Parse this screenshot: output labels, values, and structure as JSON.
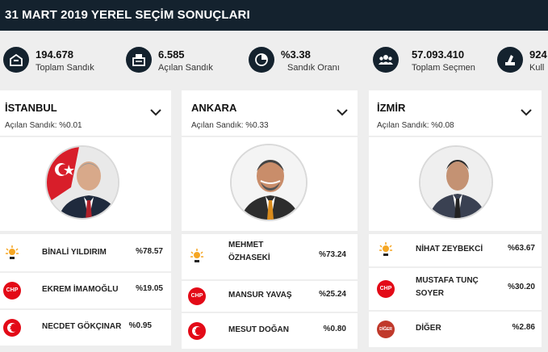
{
  "header": {
    "title": "31 MART 2019 YEREL SEÇİM SONUÇLARI"
  },
  "stats": [
    {
      "value": "194.678",
      "label": "Toplam Sandık",
      "icon": "ballot-box-icon"
    },
    {
      "value": "6.585",
      "label": "Açılan Sandık",
      "icon": "open-box-icon"
    },
    {
      "value": "%3.38",
      "label": "Sandık Oranı",
      "icon": "pie-chart-icon"
    },
    {
      "value": "57.093.410",
      "label": "Toplam Seçmen",
      "icon": "people-icon"
    },
    {
      "value": "924",
      "label": "Kull",
      "icon": "vote-icon"
    }
  ],
  "cities": [
    {
      "name": "İSTANBUL",
      "opened": "Açılan Sandık: %0.01",
      "candidates": [
        {
          "name": "BİNALİ YILDIRIM",
          "pct": "%78.57",
          "party": "akp"
        },
        {
          "name": "EKREM İMAMOĞLU",
          "pct": "%19.05",
          "party": "chp"
        },
        {
          "name": "NECDET GÖKÇINAR",
          "pct": "%0.95",
          "party": "mhp"
        }
      ]
    },
    {
      "name": "ANKARA",
      "opened": "Açılan Sandık: %0.33",
      "candidates": [
        {
          "name": "MEHMET",
          "name2": "ÖZHASEKİ",
          "pct": "%73.24",
          "party": "akp"
        },
        {
          "name": "MANSUR YAVAŞ",
          "pct": "%25.24",
          "party": "chp"
        },
        {
          "name": "MESUT DOĞAN",
          "pct": "%0.80",
          "party": "mhp"
        }
      ]
    },
    {
      "name": "İZMİR",
      "opened": "Açılan Sandık: %0.08",
      "candidates": [
        {
          "name": "NİHAT ZEYBEKCİ",
          "pct": "%63.67",
          "party": "akp"
        },
        {
          "name": "MUSTAFA TUNÇ",
          "name2": "SOYER",
          "pct": "%30.20",
          "party": "chp"
        },
        {
          "name": "DİĞER",
          "pct": "%2.86",
          "party": "other"
        }
      ]
    }
  ],
  "party_labels": {
    "chp": "CHP",
    "other": "DİĞER"
  },
  "colors": {
    "header_bg": "#14222e",
    "chp_red": "#e30a17",
    "akp_yellow": "#f5a623"
  }
}
